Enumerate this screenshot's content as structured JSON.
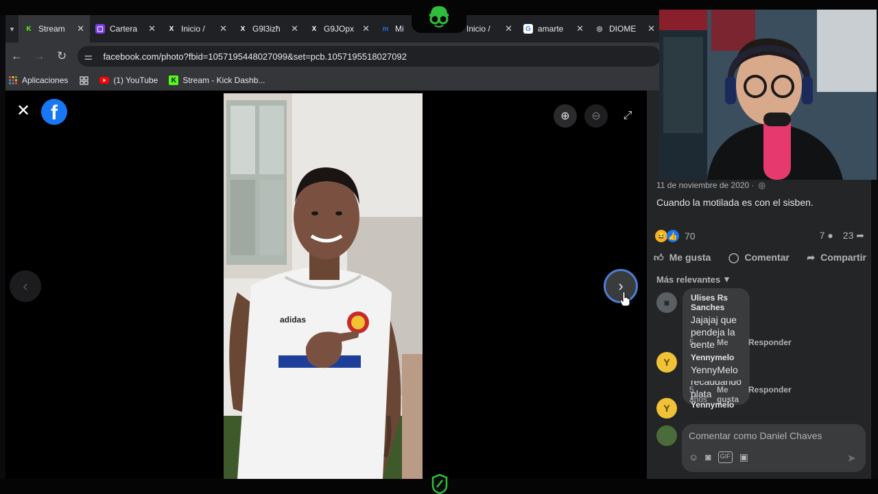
{
  "browser": {
    "tabs": [
      {
        "label": "Stream",
        "fav_letter": "K",
        "fav_color": "#53fc18",
        "fav_bg": "transparent"
      },
      {
        "label": "Carterа",
        "fav_letter": "▢",
        "fav_color": "#ffffff",
        "fav_bg": "#7b3fe4"
      },
      {
        "label": "Inicio /",
        "fav_letter": "X",
        "fav_color": "#ffffff",
        "fav_bg": "transparent"
      },
      {
        "label": "G9l3izħ",
        "fav_letter": "X",
        "fav_color": "#ffffff",
        "fav_bg": "transparent"
      },
      {
        "label": "G9JOpх",
        "fav_letter": "X",
        "fav_color": "#ffffff",
        "fav_bg": "transparent"
      },
      {
        "label": "Mi",
        "fav_letter": "m",
        "fav_color": "#1a73e8",
        "fav_bg": "transparent"
      },
      {
        "label": "Inicio /",
        "fav_letter": "X",
        "fav_color": "#ffffff",
        "fav_bg": "transparent"
      },
      {
        "label": "amarte",
        "fav_letter": "G",
        "fav_color": "#4285f4",
        "fav_bg": "#ffffff"
      },
      {
        "label": "DIOME",
        "fav_letter": "◎",
        "fav_color": "#cfcfcf",
        "fav_bg": "transparent"
      }
    ],
    "url": "facebook.com/photo?fbid=1057195448027099&set=pcb.1057195518027092",
    "bookmarks": [
      {
        "label": "Aplicaciones",
        "icon": "apps-grid-icon"
      },
      {
        "label": "",
        "icon": "grid-icon"
      },
      {
        "label": "(1) YouTube",
        "icon": "youtube-icon"
      },
      {
        "label": "Stream - Kick Dashb...",
        "icon": "kick-icon"
      }
    ]
  },
  "viewer": {
    "close_icon": "✕",
    "fb_letter": "f",
    "zoom_in_icon": "⊕",
    "zoom_out_icon": "⊖",
    "expand_icon": "⤢",
    "prev_icon": "‹",
    "next_icon": "›"
  },
  "post": {
    "date": "11 de noviembre de 2020 ·",
    "globe_icon": "◎",
    "text": "Cuando la motilada es con el sisben.",
    "reaction_count": "70",
    "comment_count": "7",
    "share_count": "23",
    "actions": {
      "like": "Me gusta",
      "comment": "Comentar",
      "share": "Compartir"
    },
    "sort_label": "Más relevantes",
    "comments": [
      {
        "name": "Ulises Rs Sanches",
        "text_lines": [
          "Jajajaj que pendeja la gente encima",
          "y el recaudando plata"
        ],
        "time": "5 años",
        "like": "Me gusta",
        "reply": "Responder",
        "avatar": "■"
      },
      {
        "name": "Yennymelo",
        "text_lines": [
          "YennyMelo"
        ],
        "time": "5 años",
        "like": "Me gusta",
        "reply": "Responder",
        "avatar": "Y"
      },
      {
        "name": "Yennymelo",
        "text_lines": [],
        "avatar": "Y"
      }
    ],
    "composer_placeholder": "Comentar como Daniel Chaves"
  },
  "colors": {
    "fb_blue": "#1877f2",
    "panel_bg": "#242526",
    "bubble_bg": "#3a3b3c",
    "next_ring": "#4b7fd6",
    "stream_green": "#53fc18"
  }
}
